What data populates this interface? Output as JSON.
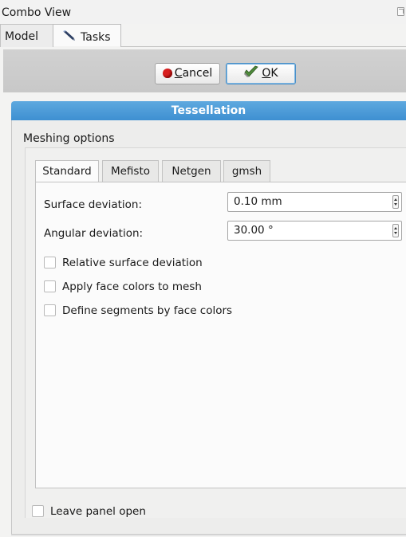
{
  "combo_view": {
    "title": "Combo View",
    "tabs": [
      {
        "label": "Model",
        "active": false
      },
      {
        "label": "Tasks",
        "active": true
      }
    ]
  },
  "buttons": {
    "cancel_label": "Cancel",
    "cancel_mnemonic": "C",
    "ok_label": "OK",
    "ok_mnemonic": "O"
  },
  "panel": {
    "title": "Tessellation",
    "group_title": "Meshing options",
    "tabs": [
      {
        "label": "Standard",
        "active": true
      },
      {
        "label": "Mefisto",
        "active": false
      },
      {
        "label": "Netgen",
        "active": false
      },
      {
        "label": "gmsh",
        "active": false
      }
    ],
    "standard": {
      "surface_deviation_label": "Surface deviation:",
      "surface_deviation_value": "0.10 mm",
      "angular_deviation_label": "Angular deviation:",
      "angular_deviation_value": "30.00 °",
      "checkboxes": [
        {
          "label": "Relative surface deviation",
          "checked": false
        },
        {
          "label": "Apply face colors to mesh",
          "checked": false
        },
        {
          "label": "Define segments by face colors",
          "checked": false
        }
      ]
    },
    "leave_panel_open": {
      "label": "Leave panel open",
      "checked": false
    }
  },
  "colors": {
    "title_bar": "#3e8fd1",
    "cancel_icon": "#d81e1e",
    "ok_icon": "#4f8a3c"
  },
  "icons": {
    "tasks_tab": "pencil-icon",
    "cancel": "red-circle-icon",
    "ok": "green-check-icon",
    "combo_float": "float-window-icon"
  }
}
